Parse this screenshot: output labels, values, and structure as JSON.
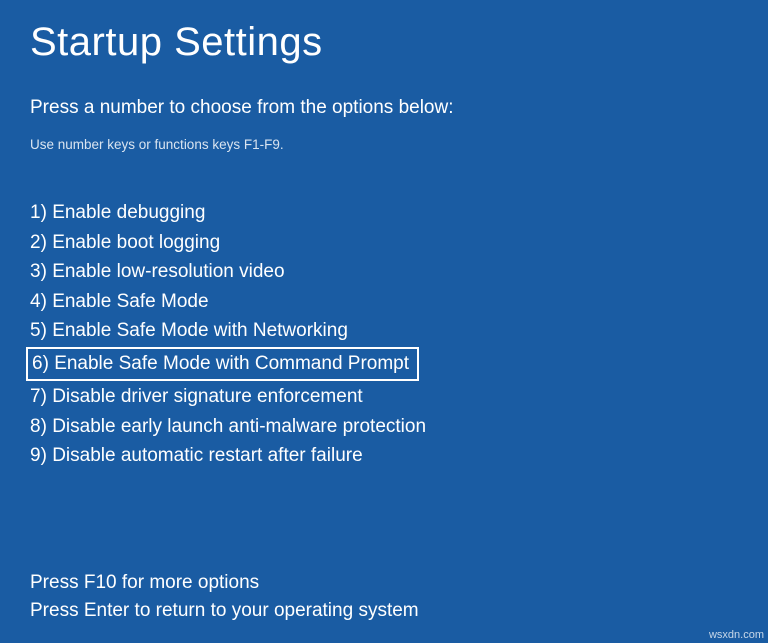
{
  "title": "Startup Settings",
  "subtitle": "Press a number to choose from the options below:",
  "hint": "Use number keys or functions keys F1-F9.",
  "options": [
    {
      "num": "1",
      "label": "Enable debugging",
      "highlighted": false
    },
    {
      "num": "2",
      "label": "Enable boot logging",
      "highlighted": false
    },
    {
      "num": "3",
      "label": "Enable low-resolution video",
      "highlighted": false
    },
    {
      "num": "4",
      "label": "Enable Safe Mode",
      "highlighted": false
    },
    {
      "num": "5",
      "label": "Enable Safe Mode with Networking",
      "highlighted": false
    },
    {
      "num": "6",
      "label": "Enable Safe Mode with Command Prompt",
      "highlighted": true
    },
    {
      "num": "7",
      "label": "Disable driver signature enforcement",
      "highlighted": false
    },
    {
      "num": "8",
      "label": "Disable early launch anti-malware protection",
      "highlighted": false
    },
    {
      "num": "9",
      "label": "Disable automatic restart after failure",
      "highlighted": false
    }
  ],
  "footer": {
    "more": "Press F10 for more options",
    "return": "Press Enter to return to your operating system"
  },
  "watermark": "wsxdn.com"
}
